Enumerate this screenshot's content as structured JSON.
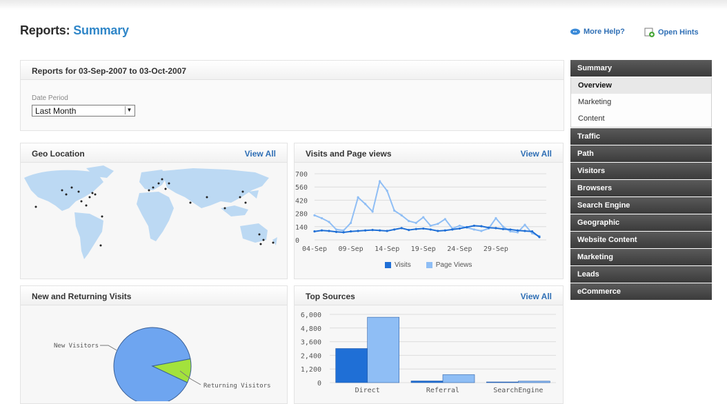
{
  "header": {
    "title_prefix": "Reports:",
    "title_sub": "Summary",
    "more_help": "More Help?",
    "open_hints": "Open Hints"
  },
  "report_range": {
    "title": "Reports for 03-Sep-2007 to 03-Oct-2007",
    "date_period_label": "Date Period",
    "date_period_value": "Last Month"
  },
  "geo": {
    "title": "Geo Location",
    "view_all": "View All"
  },
  "visits": {
    "title": "Visits and Page views",
    "view_all": "View All"
  },
  "returning": {
    "title": "New and Returning Visits"
  },
  "sources": {
    "title": "Top Sources",
    "view_all": "View All"
  },
  "sidebar": {
    "summary": "Summary",
    "sub": [
      "Overview",
      "Marketing",
      "Content"
    ],
    "items": [
      "Traffic",
      "Path",
      "Visitors",
      "Browsers",
      "Search Engine",
      "Geographic",
      "Website Content",
      "Marketing",
      "Leads",
      "eCommerce"
    ]
  },
  "colors": {
    "accent": "#2f86c8",
    "visits": "#1f6fd6",
    "page_views": "#8fbef5",
    "map_land": "#bcd9f3",
    "pie_new": "#6ea5f0",
    "pie_returning": "#a3e23c"
  },
  "chart_data": [
    {
      "type": "line",
      "x_tick_labels": [
        "04-Sep",
        "09-Sep",
        "14-Sep",
        "19-Sep",
        "24-Sep",
        "29-Sep"
      ],
      "y_ticks": [
        0,
        140,
        280,
        420,
        560,
        700
      ],
      "ylim": [
        0,
        700
      ],
      "series": [
        {
          "name": "Visits",
          "values": [
            90,
            100,
            95,
            85,
            80,
            90,
            95,
            100,
            105,
            100,
            95,
            110,
            125,
            105,
            115,
            120,
            110,
            95,
            100,
            110,
            120,
            135,
            150,
            145,
            130,
            125,
            115,
            110,
            100,
            95,
            90,
            30
          ]
        },
        {
          "name": "Page Views",
          "values": [
            260,
            230,
            190,
            110,
            100,
            180,
            450,
            380,
            300,
            620,
            520,
            310,
            260,
            200,
            180,
            240,
            150,
            170,
            220,
            120,
            150,
            130,
            110,
            95,
            120,
            230,
            140,
            90,
            80,
            160,
            70,
            40
          ]
        }
      ],
      "legend": [
        "Visits",
        "Page Views"
      ]
    },
    {
      "type": "pie",
      "labels": [
        "New Visitors",
        "Returning Visitors"
      ],
      "values": [
        90,
        10
      ]
    },
    {
      "type": "bar",
      "categories": [
        "Direct",
        "Referral",
        "SearchEngine"
      ],
      "y_ticks": [
        "0",
        "1,200",
        "2,400",
        "3,600",
        "4,800",
        "6,000"
      ],
      "ylim": [
        0,
        6000
      ],
      "series": [
        {
          "name": "Visits",
          "values": [
            3000,
            150,
            60
          ]
        },
        {
          "name": "Page Views",
          "values": [
            5750,
            700,
            130
          ]
        }
      ]
    }
  ]
}
